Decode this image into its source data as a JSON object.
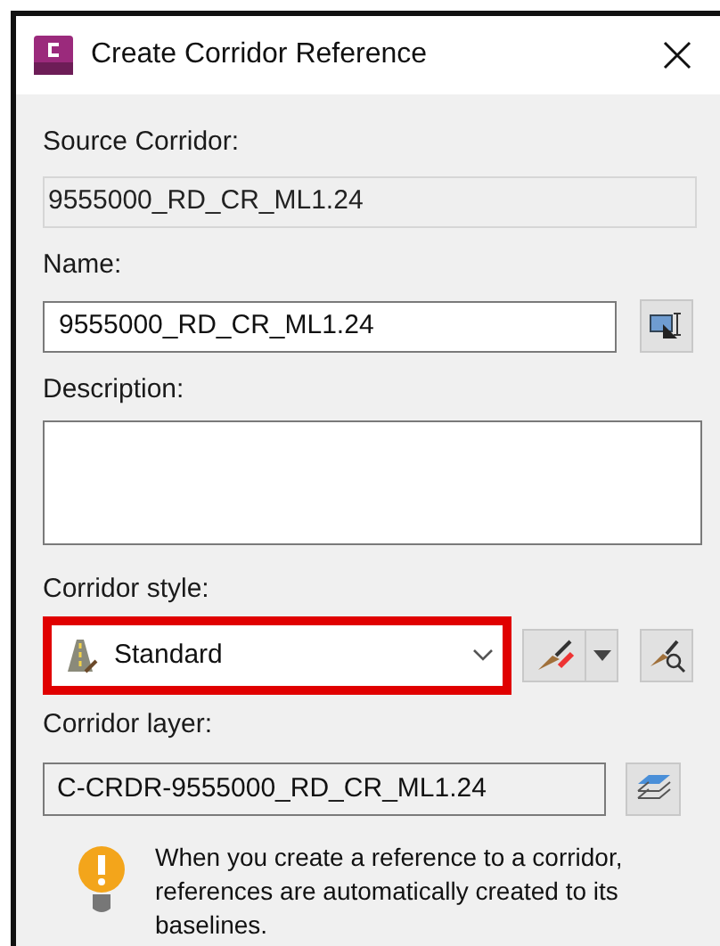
{
  "window": {
    "title": "Create Corridor Reference"
  },
  "source_corridor": {
    "label": "Source Corridor:",
    "value": "9555000_RD_CR_ML1.24",
    "disabled": true
  },
  "name": {
    "label": "Name:",
    "value": "9555000_RD_CR_ML1.24"
  },
  "description": {
    "label": "Description:"
  },
  "corridor_style": {
    "label": "Corridor style:",
    "value": "Standard",
    "highlighted": true
  },
  "corridor_layer": {
    "label": "Corridor layer:",
    "value": "C-CRDR-9555000_RD_CR_ML1.24"
  },
  "note": {
    "text": "When you create a reference to a corridor, references are automatically created to its baselines."
  }
}
